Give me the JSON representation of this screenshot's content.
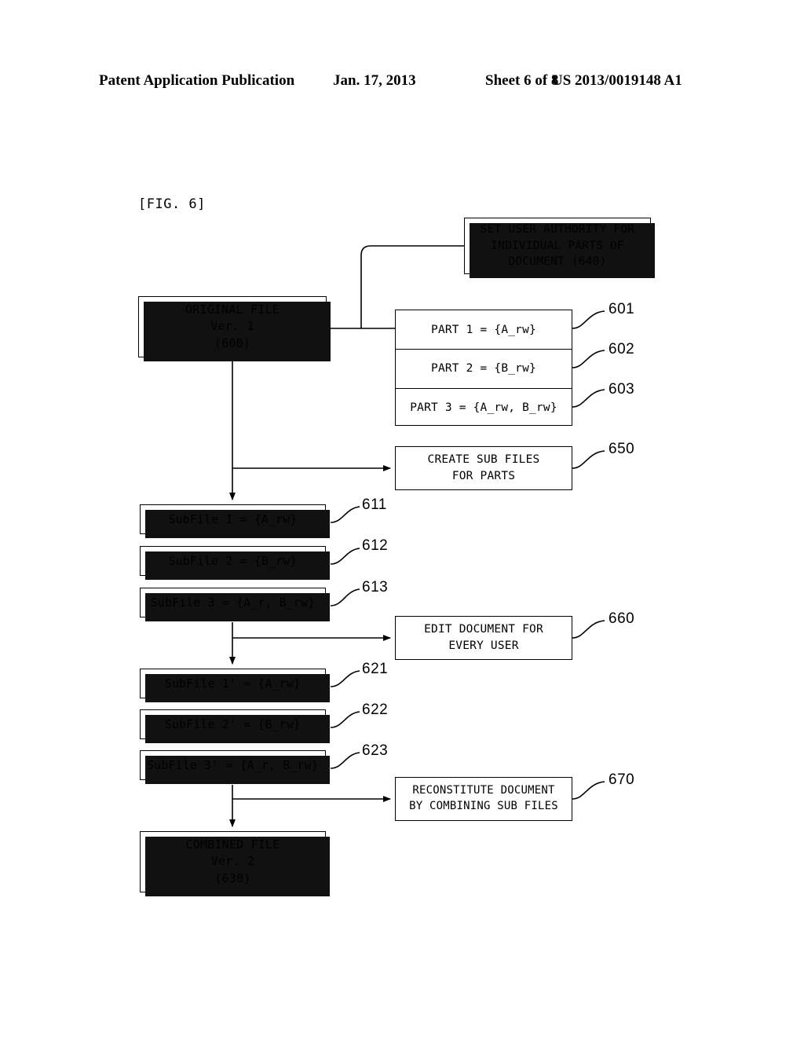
{
  "header": {
    "publication": "Patent Application Publication",
    "date": "Jan. 17, 2013",
    "sheet": "Sheet 6 of 8",
    "doc_number": "US 2013/0019148 A1"
  },
  "figure": {
    "label": "[FIG. 6]"
  },
  "boxes": {
    "authority": {
      "line1": "SET USER AUTHORITY FOR",
      "line2": "INDIVIDUAL PARTS OF",
      "line3": "DOCUMENT (640)"
    },
    "original_file": {
      "line1": "ORIGINAL FILE",
      "line2": "Ver. 1",
      "line3": "(600)"
    },
    "create_sub_files": {
      "line1": "CREATE SUB FILES",
      "line2": "FOR PARTS"
    },
    "edit_document": {
      "line1": "EDIT DOCUMENT FOR",
      "line2": "EVERY USER"
    },
    "reconstitute": {
      "line1": "RECONSTITUTE DOCUMENT",
      "line2": "BY COMBINING SUB FILES"
    },
    "combined_file": {
      "line1": "COMBINED FILE",
      "line2": "Ver. 2",
      "line3": "(630)"
    }
  },
  "parts": [
    {
      "label": "PART 1 = {A_rw}",
      "ref": "601"
    },
    {
      "label": "PART 2 = {B_rw}",
      "ref": "602"
    },
    {
      "label": "PART 3 = {A_rw, B_rw}",
      "ref": "603"
    }
  ],
  "sub_files": [
    {
      "label": "SubFile 1 = {A_rw}",
      "ref": "611"
    },
    {
      "label": "SubFile 2 = {B_rw}",
      "ref": "612"
    },
    {
      "label": "SubFile 3 = {A_r, B_rw}",
      "ref": "613"
    }
  ],
  "edited_sub_files": [
    {
      "label": "SubFile 1' = {A_rw}",
      "ref": "621"
    },
    {
      "label": "SubFile 2' = {B_rw}",
      "ref": "622"
    },
    {
      "label": "SubFile 3' = {A_r, B_rw}",
      "ref": "623"
    }
  ],
  "process_refs": {
    "create_sub_files": "650",
    "edit_document": "660",
    "reconstitute": "670"
  },
  "colors": {
    "ink": "#000000",
    "paper": "#ffffff",
    "shadow": "#111111"
  }
}
